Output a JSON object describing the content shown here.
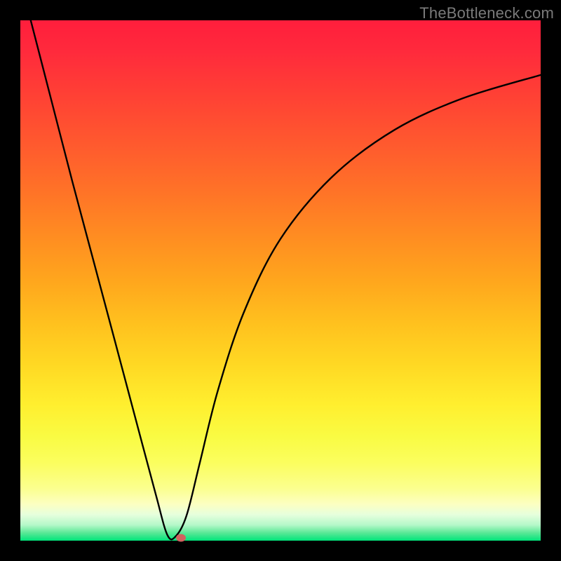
{
  "watermark": "TheBottleneck.com",
  "chart_data": {
    "type": "line",
    "title": "",
    "xlabel": "",
    "ylabel": "",
    "xlim": [
      0,
      1
    ],
    "ylim": [
      0,
      1
    ],
    "grid": false,
    "legend": false,
    "series": [
      {
        "name": "curve",
        "x": [
          0.02,
          0.06,
          0.1,
          0.14,
          0.18,
          0.22,
          0.26,
          0.283,
          0.3,
          0.32,
          0.345,
          0.38,
          0.43,
          0.5,
          0.6,
          0.72,
          0.85,
          1.0
        ],
        "y": [
          1.0,
          0.845,
          0.69,
          0.54,
          0.39,
          0.24,
          0.09,
          0.01,
          0.01,
          0.05,
          0.15,
          0.29,
          0.44,
          0.58,
          0.7,
          0.79,
          0.85,
          0.895
        ]
      }
    ],
    "marker": {
      "x": 0.308,
      "y": 0.005
    },
    "colors": {
      "curve": "#000000",
      "marker": "#d1625f",
      "gradient_top": "#ff1e3c",
      "gradient_bottom": "#00e47a"
    }
  }
}
